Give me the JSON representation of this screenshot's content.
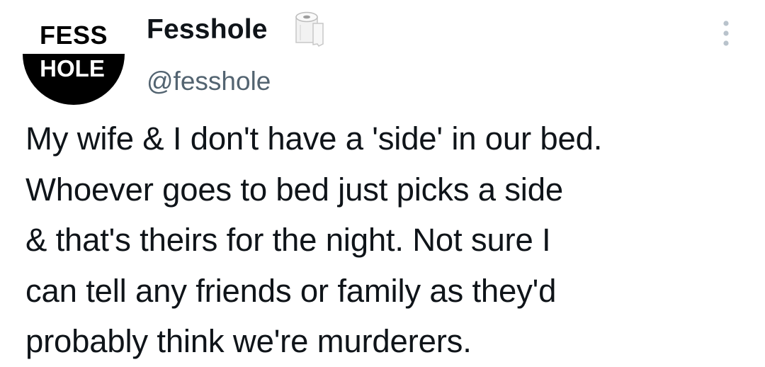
{
  "author": {
    "avatar_text_top": "FESS",
    "avatar_text_bottom": "HOLE",
    "display_name": "Fesshole",
    "name_emoji_icon": "toilet-paper-icon",
    "handle": "@fesshole"
  },
  "menu": {
    "more_icon": "more-vertical-icon"
  },
  "tweet": {
    "text": "My wife & I don't have a 'side' in our bed.\nWhoever goes to bed just picks a side\n& that's theirs for the night. Not sure I\ncan tell any friends or family as they'd\nprobably think we're murderers."
  },
  "colors": {
    "text": "#0f1419",
    "secondary": "#536471",
    "avatar_bg": "#000000"
  }
}
